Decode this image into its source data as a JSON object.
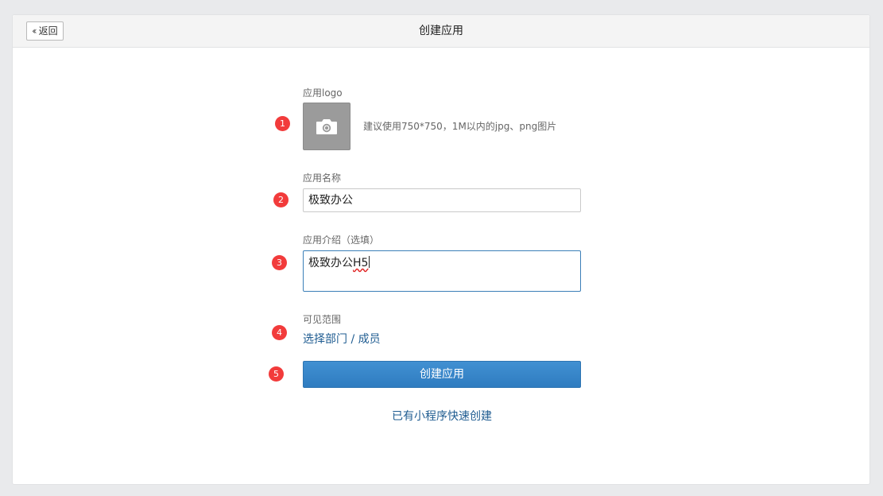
{
  "header": {
    "back_label": "返回",
    "title": "创建应用"
  },
  "form": {
    "logo": {
      "label": "应用logo",
      "hint": "建议使用750*750，1M以内的jpg、png图片",
      "icon": "camera-icon"
    },
    "name": {
      "label": "应用名称",
      "value": "极致办公"
    },
    "description": {
      "label": "应用介绍（选填）",
      "value_prefix": "极致办公",
      "value_misspelled": "H5"
    },
    "visibility": {
      "label": "可见范围",
      "link": "选择部门 / 成员"
    },
    "submit_label": "创建应用",
    "mini_program_link": "已有小程序快速创建"
  },
  "steps": [
    "1",
    "2",
    "3",
    "4",
    "5"
  ],
  "colors": {
    "accent": "#3584c8",
    "link": "#1f5c91",
    "step_badge": "#f23b3b"
  }
}
